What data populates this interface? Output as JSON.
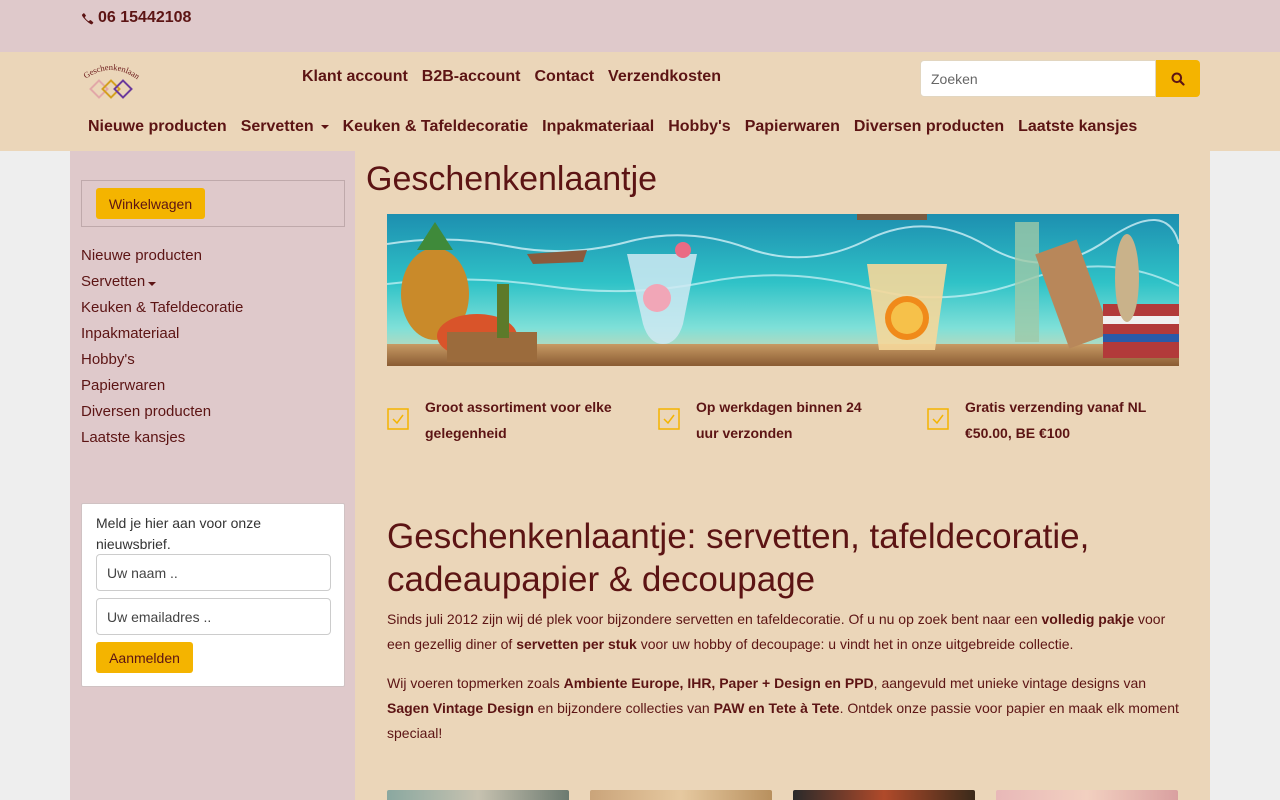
{
  "topbar": {
    "phone": "06 15442108"
  },
  "header": {
    "logo_text": "Geschenkenlaantje",
    "top_links": [
      "Klant account",
      "B2B-account",
      "Contact",
      "Verzendkosten"
    ],
    "search_placeholder": "Zoeken"
  },
  "main_nav": {
    "items": [
      "Nieuwe producten",
      "Servetten",
      "Keuken & Tafeldecoratie",
      "Inpakmateriaal",
      "Hobby's",
      "Papierwaren",
      "Diversen producten",
      "Laatste kansjes"
    ]
  },
  "sidebar": {
    "cart_button": "Winkelwagen",
    "items": [
      "Nieuwe producten",
      "Servetten",
      "Keuken & Tafeldecoratie",
      "Inpakmateriaal",
      "Hobby's",
      "Papierwaren",
      "Diversen producten",
      "Laatste kansjes"
    ],
    "newsletter": {
      "text": "Meld je hier aan voor onze nieuwsbrief.",
      "name_placeholder": "Uw naam ..",
      "email_placeholder": "Uw emailadres ..",
      "submit": "Aanmelden"
    }
  },
  "content": {
    "title": "Geschenkenlaantje",
    "usps": [
      "Groot assortiment voor elke gelegenheid",
      "Op werkdagen binnen 24 uur verzonden",
      "Gratis verzending vanaf NL €50.00, BE €100"
    ],
    "intro_heading": "Geschenkenlaantje: servetten, tafeldecoratie, cadeaupapier & decoupage",
    "p1": {
      "t1": "Sinds juli 2012 zijn wij dé plek voor bijzondere servetten en tafeldecoratie. Of u nu op zoek bent naar een ",
      "b1": "volledig pakje",
      "t2": " voor een gezellig diner of ",
      "b2": "servetten per stuk",
      "t3": " voor uw hobby of decoupage: u vindt het in onze uitgebreide collectie."
    },
    "p2": {
      "t1": "Wij voeren topmerken zoals ",
      "b1": "Ambiente Europe, IHR, Paper + Design en PPD",
      "t2": ", aangevuld met unieke vintage designs van ",
      "b2": "Sagen Vintage Design",
      "t3": " en bijzondere collecties van ",
      "b3": "PAW en Tete à Tete",
      "t4": ". Ontdek onze passie voor papier en maak elk moment speciaal!"
    }
  },
  "colors": {
    "topbar": "#dfc9cb",
    "header": "#ebd6b9",
    "text": "#5c1414",
    "accent": "#f4b400"
  }
}
